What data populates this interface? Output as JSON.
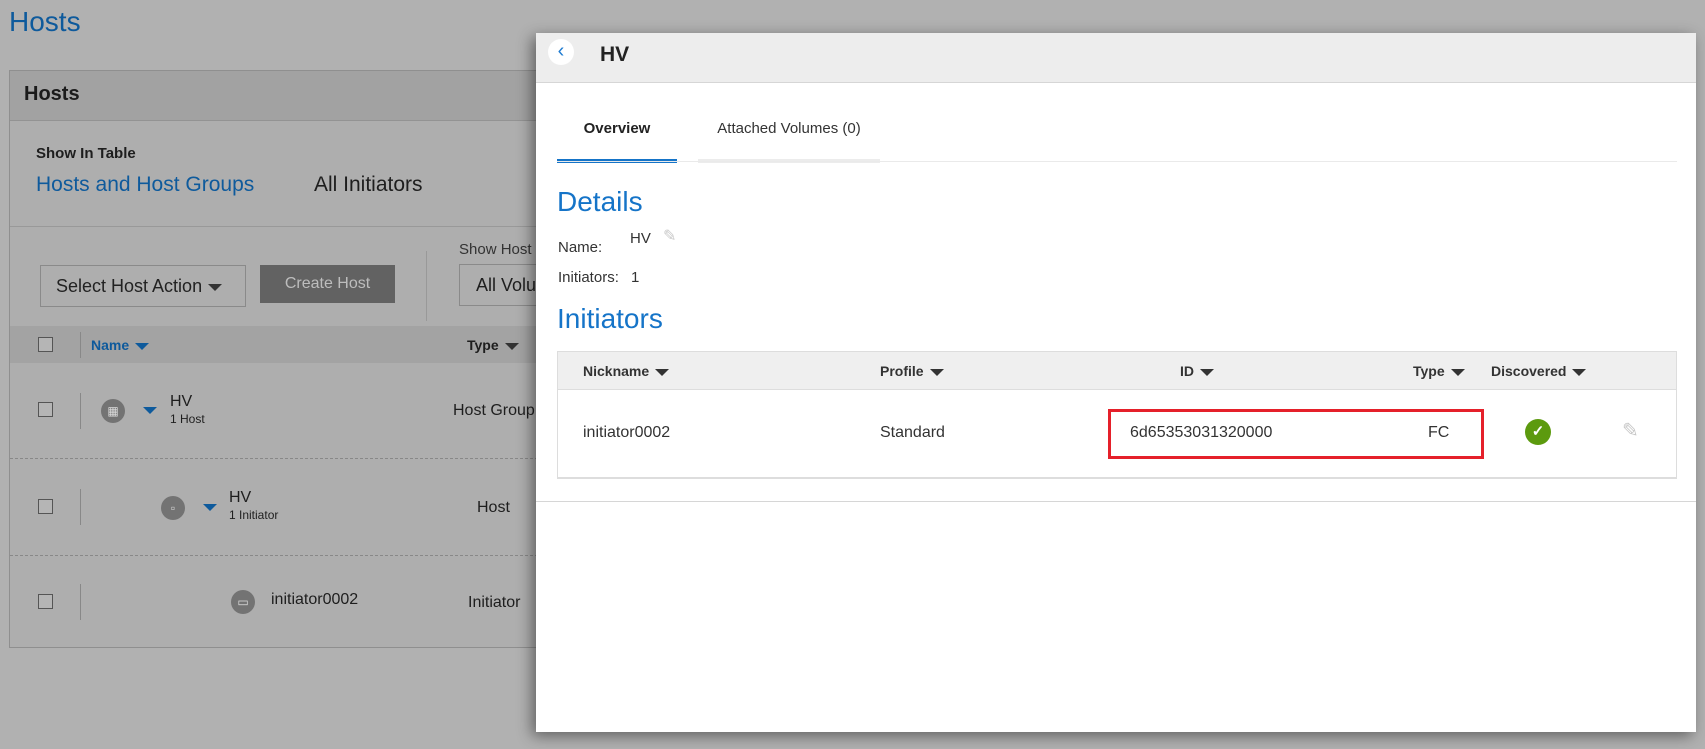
{
  "page_title": "Hosts",
  "hosts_panel": {
    "title": "Hosts",
    "show_in_table_label": "Show In Table",
    "view_hosts_link": "Hosts and Host Groups",
    "view_initiators": "All Initiators",
    "select_action": "Select Host Action",
    "create_host": "Create Host",
    "show_hosts_label": "Show Host",
    "show_hosts_value": "All Volu",
    "columns": {
      "name": "Name",
      "type": "Type"
    },
    "rows": [
      {
        "name": "HV",
        "sub": "1 Host",
        "type": "Host Group",
        "icon": "host-group-icon"
      },
      {
        "name": "HV",
        "sub": "1 Initiator",
        "type": "Host",
        "icon": "host-icon"
      },
      {
        "name": "initiator0002",
        "sub": "",
        "type": "Initiator",
        "icon": "initiator-icon"
      }
    ]
  },
  "detail": {
    "title": "HV",
    "tabs": [
      {
        "label": "Overview",
        "active": true
      },
      {
        "label": "Attached Volumes (0)",
        "active": false
      }
    ],
    "details_heading": "Details",
    "name_label": "Name:",
    "name_value": "HV",
    "initiators_label": "Initiators:",
    "initiators_value": "1",
    "initiators_heading": "Initiators",
    "columns": {
      "nickname": "Nickname",
      "profile": "Profile",
      "id": "ID",
      "type": "Type",
      "discovered": "Discovered"
    },
    "rows": [
      {
        "nickname": "initiator0002",
        "profile": "Standard",
        "id": "6d65353031320000",
        "type": "FC",
        "discovered": true
      }
    ]
  },
  "colors": {
    "accent": "#1574c8",
    "highlight": "#e5202a",
    "success": "#5c9a0e"
  }
}
